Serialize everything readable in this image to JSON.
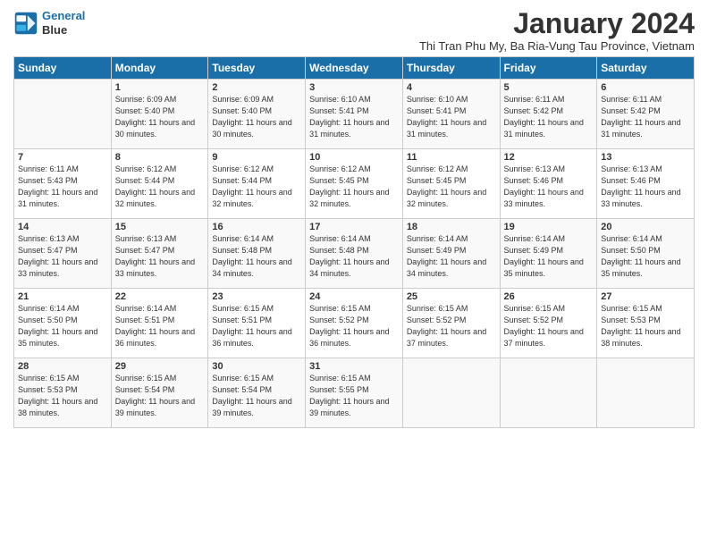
{
  "header": {
    "logo_line1": "General",
    "logo_line2": "Blue",
    "title": "January 2024",
    "subtitle": "Thi Tran Phu My, Ba Ria-Vung Tau Province, Vietnam"
  },
  "weekdays": [
    "Sunday",
    "Monday",
    "Tuesday",
    "Wednesday",
    "Thursday",
    "Friday",
    "Saturday"
  ],
  "weeks": [
    [
      {
        "day": "",
        "sunrise": "",
        "sunset": "",
        "daylight": ""
      },
      {
        "day": "1",
        "sunrise": "Sunrise: 6:09 AM",
        "sunset": "Sunset: 5:40 PM",
        "daylight": "Daylight: 11 hours and 30 minutes."
      },
      {
        "day": "2",
        "sunrise": "Sunrise: 6:09 AM",
        "sunset": "Sunset: 5:40 PM",
        "daylight": "Daylight: 11 hours and 30 minutes."
      },
      {
        "day": "3",
        "sunrise": "Sunrise: 6:10 AM",
        "sunset": "Sunset: 5:41 PM",
        "daylight": "Daylight: 11 hours and 31 minutes."
      },
      {
        "day": "4",
        "sunrise": "Sunrise: 6:10 AM",
        "sunset": "Sunset: 5:41 PM",
        "daylight": "Daylight: 11 hours and 31 minutes."
      },
      {
        "day": "5",
        "sunrise": "Sunrise: 6:11 AM",
        "sunset": "Sunset: 5:42 PM",
        "daylight": "Daylight: 11 hours and 31 minutes."
      },
      {
        "day": "6",
        "sunrise": "Sunrise: 6:11 AM",
        "sunset": "Sunset: 5:42 PM",
        "daylight": "Daylight: 11 hours and 31 minutes."
      }
    ],
    [
      {
        "day": "7",
        "sunrise": "Sunrise: 6:11 AM",
        "sunset": "Sunset: 5:43 PM",
        "daylight": "Daylight: 11 hours and 31 minutes."
      },
      {
        "day": "8",
        "sunrise": "Sunrise: 6:12 AM",
        "sunset": "Sunset: 5:44 PM",
        "daylight": "Daylight: 11 hours and 32 minutes."
      },
      {
        "day": "9",
        "sunrise": "Sunrise: 6:12 AM",
        "sunset": "Sunset: 5:44 PM",
        "daylight": "Daylight: 11 hours and 32 minutes."
      },
      {
        "day": "10",
        "sunrise": "Sunrise: 6:12 AM",
        "sunset": "Sunset: 5:45 PM",
        "daylight": "Daylight: 11 hours and 32 minutes."
      },
      {
        "day": "11",
        "sunrise": "Sunrise: 6:12 AM",
        "sunset": "Sunset: 5:45 PM",
        "daylight": "Daylight: 11 hours and 32 minutes."
      },
      {
        "day": "12",
        "sunrise": "Sunrise: 6:13 AM",
        "sunset": "Sunset: 5:46 PM",
        "daylight": "Daylight: 11 hours and 33 minutes."
      },
      {
        "day": "13",
        "sunrise": "Sunrise: 6:13 AM",
        "sunset": "Sunset: 5:46 PM",
        "daylight": "Daylight: 11 hours and 33 minutes."
      }
    ],
    [
      {
        "day": "14",
        "sunrise": "Sunrise: 6:13 AM",
        "sunset": "Sunset: 5:47 PM",
        "daylight": "Daylight: 11 hours and 33 minutes."
      },
      {
        "day": "15",
        "sunrise": "Sunrise: 6:13 AM",
        "sunset": "Sunset: 5:47 PM",
        "daylight": "Daylight: 11 hours and 33 minutes."
      },
      {
        "day": "16",
        "sunrise": "Sunrise: 6:14 AM",
        "sunset": "Sunset: 5:48 PM",
        "daylight": "Daylight: 11 hours and 34 minutes."
      },
      {
        "day": "17",
        "sunrise": "Sunrise: 6:14 AM",
        "sunset": "Sunset: 5:48 PM",
        "daylight": "Daylight: 11 hours and 34 minutes."
      },
      {
        "day": "18",
        "sunrise": "Sunrise: 6:14 AM",
        "sunset": "Sunset: 5:49 PM",
        "daylight": "Daylight: 11 hours and 34 minutes."
      },
      {
        "day": "19",
        "sunrise": "Sunrise: 6:14 AM",
        "sunset": "Sunset: 5:49 PM",
        "daylight": "Daylight: 11 hours and 35 minutes."
      },
      {
        "day": "20",
        "sunrise": "Sunrise: 6:14 AM",
        "sunset": "Sunset: 5:50 PM",
        "daylight": "Daylight: 11 hours and 35 minutes."
      }
    ],
    [
      {
        "day": "21",
        "sunrise": "Sunrise: 6:14 AM",
        "sunset": "Sunset: 5:50 PM",
        "daylight": "Daylight: 11 hours and 35 minutes."
      },
      {
        "day": "22",
        "sunrise": "Sunrise: 6:14 AM",
        "sunset": "Sunset: 5:51 PM",
        "daylight": "Daylight: 11 hours and 36 minutes."
      },
      {
        "day": "23",
        "sunrise": "Sunrise: 6:15 AM",
        "sunset": "Sunset: 5:51 PM",
        "daylight": "Daylight: 11 hours and 36 minutes."
      },
      {
        "day": "24",
        "sunrise": "Sunrise: 6:15 AM",
        "sunset": "Sunset: 5:52 PM",
        "daylight": "Daylight: 11 hours and 36 minutes."
      },
      {
        "day": "25",
        "sunrise": "Sunrise: 6:15 AM",
        "sunset": "Sunset: 5:52 PM",
        "daylight": "Daylight: 11 hours and 37 minutes."
      },
      {
        "day": "26",
        "sunrise": "Sunrise: 6:15 AM",
        "sunset": "Sunset: 5:52 PM",
        "daylight": "Daylight: 11 hours and 37 minutes."
      },
      {
        "day": "27",
        "sunrise": "Sunrise: 6:15 AM",
        "sunset": "Sunset: 5:53 PM",
        "daylight": "Daylight: 11 hours and 38 minutes."
      }
    ],
    [
      {
        "day": "28",
        "sunrise": "Sunrise: 6:15 AM",
        "sunset": "Sunset: 5:53 PM",
        "daylight": "Daylight: 11 hours and 38 minutes."
      },
      {
        "day": "29",
        "sunrise": "Sunrise: 6:15 AM",
        "sunset": "Sunset: 5:54 PM",
        "daylight": "Daylight: 11 hours and 39 minutes."
      },
      {
        "day": "30",
        "sunrise": "Sunrise: 6:15 AM",
        "sunset": "Sunset: 5:54 PM",
        "daylight": "Daylight: 11 hours and 39 minutes."
      },
      {
        "day": "31",
        "sunrise": "Sunrise: 6:15 AM",
        "sunset": "Sunset: 5:55 PM",
        "daylight": "Daylight: 11 hours and 39 minutes."
      },
      {
        "day": "",
        "sunrise": "",
        "sunset": "",
        "daylight": ""
      },
      {
        "day": "",
        "sunrise": "",
        "sunset": "",
        "daylight": ""
      },
      {
        "day": "",
        "sunrise": "",
        "sunset": "",
        "daylight": ""
      }
    ]
  ]
}
